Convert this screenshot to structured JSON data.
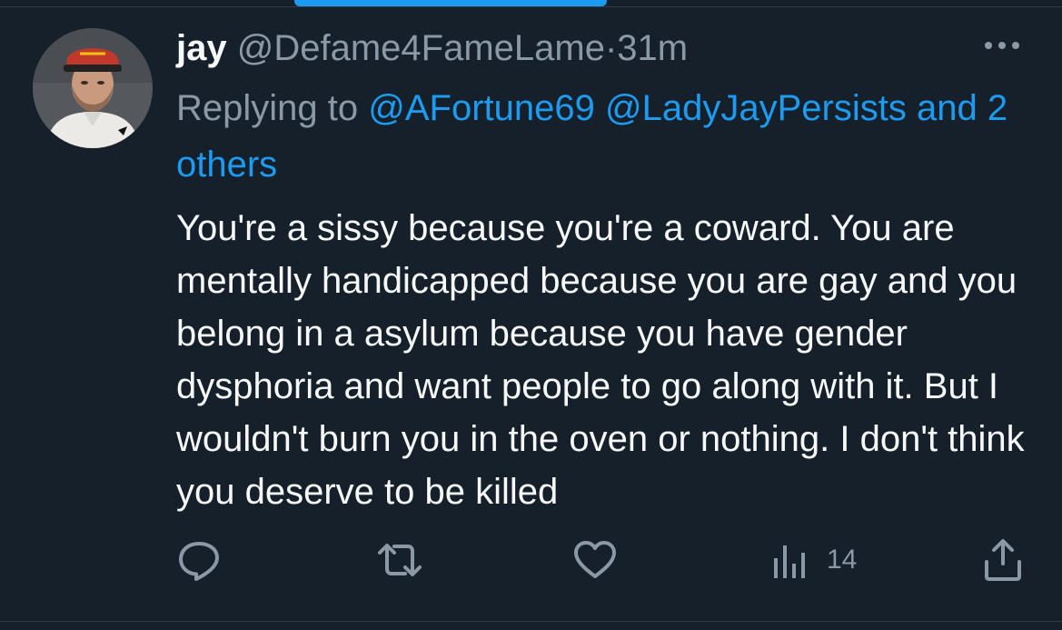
{
  "tweet": {
    "author_name": "jay",
    "handle": "@Defame4FameLame",
    "separator": "·",
    "time": "31m",
    "replying_prefix": "Replying to",
    "mentions": [
      "@AFortune69",
      "@LadyJayPersists"
    ],
    "others_text": "and 2 others",
    "body": "You're a sissy because you're a coward. You are mentally handicapped because you are gay and you belong in a asylum because you have gender dysphoria and want people to go along with it. But I wouldn't burn you in the oven or nothing. I don't think you deserve to be killed"
  },
  "actions": {
    "reply_icon": "reply-icon",
    "retweet_icon": "retweet-icon",
    "like_icon": "heart-icon",
    "views_icon": "analytics-icon",
    "views_count": "14",
    "share_icon": "share-icon"
  },
  "more_icon": "more-icon",
  "colors": {
    "background": "#15202b",
    "accent": "#1d9bf0",
    "text_primary": "#f7f9f9",
    "text_secondary": "#8b98a5"
  }
}
